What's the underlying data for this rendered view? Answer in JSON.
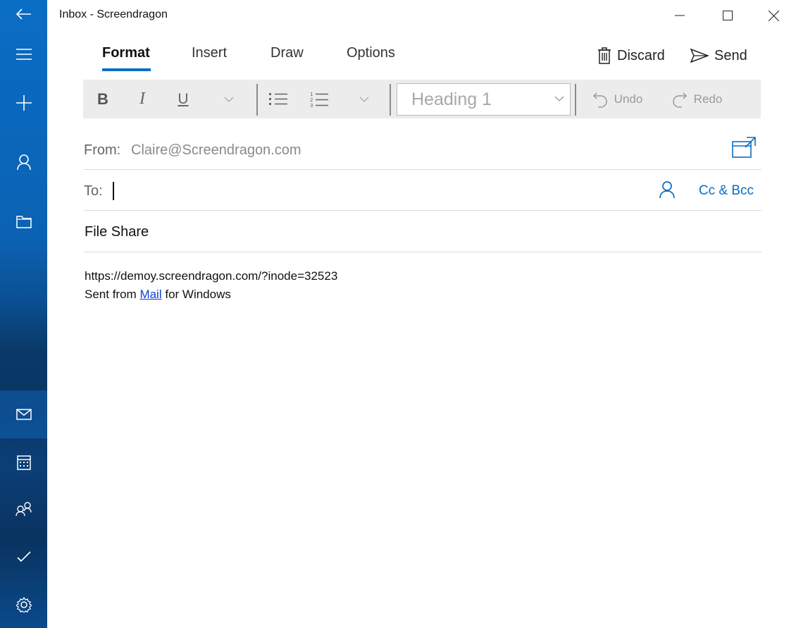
{
  "window": {
    "title": "Inbox - Screendragon"
  },
  "rail": {
    "items": [
      "back-icon",
      "menu-icon",
      "compose-icon",
      "account-icon",
      "folder-icon",
      "mail-icon",
      "calendar-icon",
      "people-icon",
      "todo-icon",
      "settings-icon"
    ]
  },
  "ribbon": {
    "tabs": [
      {
        "label": "Format",
        "active": true
      },
      {
        "label": "Insert",
        "active": false
      },
      {
        "label": "Draw",
        "active": false
      },
      {
        "label": "Options",
        "active": false
      }
    ],
    "discard_label": "Discard",
    "send_label": "Send"
  },
  "toolbar": {
    "bold": "B",
    "italic": "I",
    "underline": "U",
    "style_value": "Heading 1",
    "undo_label": "Undo",
    "redo_label": "Redo"
  },
  "compose": {
    "from_label": "From:",
    "from_value": "Claire@Screendragon.com",
    "to_label": "To:",
    "to_value": "",
    "cc_bcc_label": "Cc & Bcc",
    "subject": "File Share",
    "body_line1": "https://demoy.screendragon.com/?inode=32523",
    "body_prefix": "Sent from",
    "body_link": "Mail",
    "body_suffix": "for Windows"
  },
  "colors": {
    "accent": "#0a6dc4",
    "rail": "#0b62b3",
    "toolbar_bg": "#ececec"
  }
}
